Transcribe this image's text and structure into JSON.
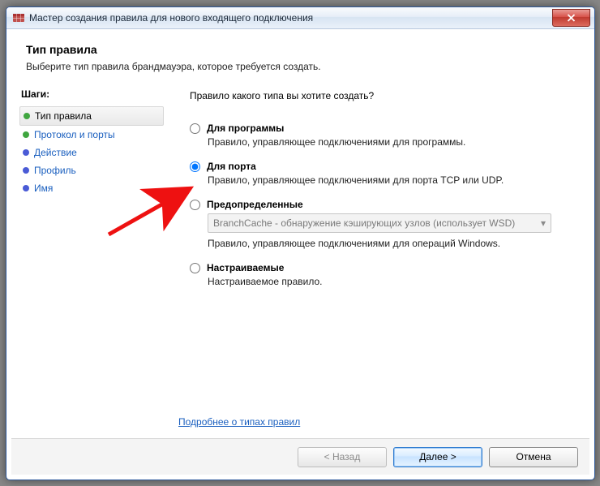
{
  "window": {
    "title": "Мастер создания правила для нового входящего подключения"
  },
  "header": {
    "title": "Тип правила",
    "subtitle": "Выберите тип правила брандмауэра, которое требуется создать."
  },
  "sidebar": {
    "heading": "Шаги:",
    "steps": [
      {
        "label": "Тип правила",
        "color": "#3fa63f",
        "active": true,
        "link": false
      },
      {
        "label": "Протокол и порты",
        "color": "#3fa63f",
        "active": false,
        "link": true
      },
      {
        "label": "Действие",
        "color": "#4a5bd6",
        "active": false,
        "link": true
      },
      {
        "label": "Профиль",
        "color": "#4a5bd6",
        "active": false,
        "link": true
      },
      {
        "label": "Имя",
        "color": "#4a5bd6",
        "active": false,
        "link": true
      }
    ]
  },
  "main": {
    "question": "Правило какого типа вы хотите создать?",
    "options": [
      {
        "id": "program",
        "label": "Для программы",
        "desc": "Правило, управляющее подключениями для программы.",
        "checked": false,
        "hasCombo": false
      },
      {
        "id": "port",
        "label": "Для порта",
        "desc": "Правило, управляющее подключениями для порта TCP или UDP.",
        "checked": true,
        "hasCombo": false
      },
      {
        "id": "predef",
        "label": "Предопределенные",
        "desc": "Правило, управляющее подключениями для операций Windows.",
        "checked": false,
        "hasCombo": true,
        "comboValue": "BranchCache - обнаружение кэширующих узлов (использует WSD)"
      },
      {
        "id": "custom",
        "label": "Настраиваемые",
        "desc": "Настраиваемое правило.",
        "checked": false,
        "hasCombo": false
      }
    ],
    "learn_more": "Подробнее о типах правил"
  },
  "footer": {
    "back": "< Назад",
    "next": "Далее >",
    "cancel": "Отмена"
  }
}
